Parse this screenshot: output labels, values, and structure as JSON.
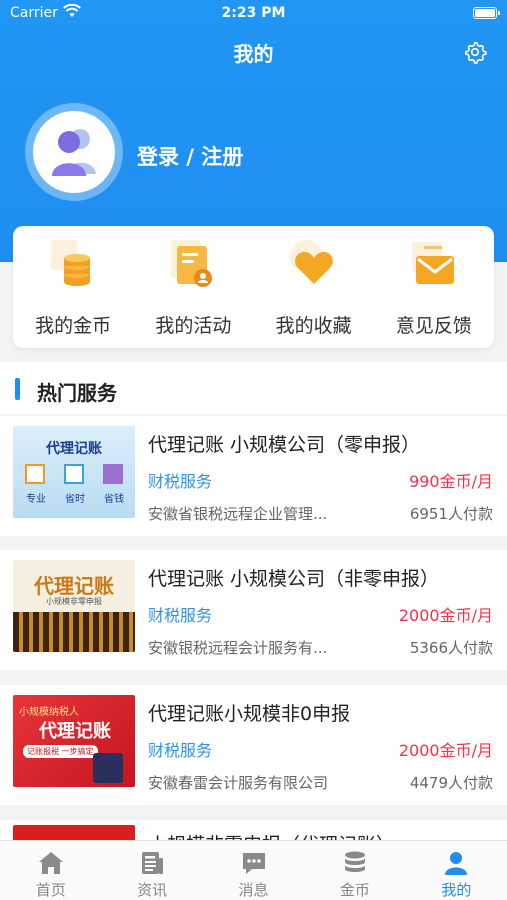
{
  "status_bar": {
    "carrier": "Carrier",
    "time": "2:23 PM"
  },
  "header": {
    "title": "我的",
    "login_text": "登录 / 注册"
  },
  "quick_actions": [
    {
      "label": "我的金币",
      "icon": "coins-icon"
    },
    {
      "label": "我的活动",
      "icon": "activity-icon"
    },
    {
      "label": "我的收藏",
      "icon": "heart-icon"
    },
    {
      "label": "意见反馈",
      "icon": "mail-icon"
    }
  ],
  "section": {
    "title": "热门服务"
  },
  "services": [
    {
      "name": "代理记账   小规模公司（零申报）",
      "category": "财税服务",
      "price": "990金币/月",
      "company": "安徽省银税远程企业管理...",
      "paid": "6951人付款",
      "thumb_text": [
        "代理记账",
        "专业",
        "省时",
        "省钱"
      ]
    },
    {
      "name": "代理记账   小规模公司（非零申报）",
      "category": "财税服务",
      "price": "2000金币/月",
      "company": "安徽银税远程会计服务有...",
      "paid": "5366人付款",
      "thumb_text": [
        "代理记账",
        "小规模非零申报"
      ]
    },
    {
      "name": "代理记账小规模非0申报",
      "category": "财税服务",
      "price": "2000金币/月",
      "company": "安徽春雷会计服务有限公司",
      "paid": "4479人付款",
      "thumb_text": [
        "小规模纳税人",
        "代理记账",
        "记账报税 一步搞定"
      ]
    },
    {
      "name": "小规模非零申报（代理记账）"
    }
  ],
  "tabs": [
    {
      "label": "首页",
      "icon": "home-icon"
    },
    {
      "label": "资讯",
      "icon": "news-icon"
    },
    {
      "label": "消息",
      "icon": "chat-icon"
    },
    {
      "label": "金币",
      "icon": "coin-stack-icon"
    },
    {
      "label": "我的",
      "icon": "user-icon",
      "active": true
    }
  ],
  "colors": {
    "primary": "#1f8ef1",
    "price": "#f0334b",
    "category": "#2e93e8"
  }
}
